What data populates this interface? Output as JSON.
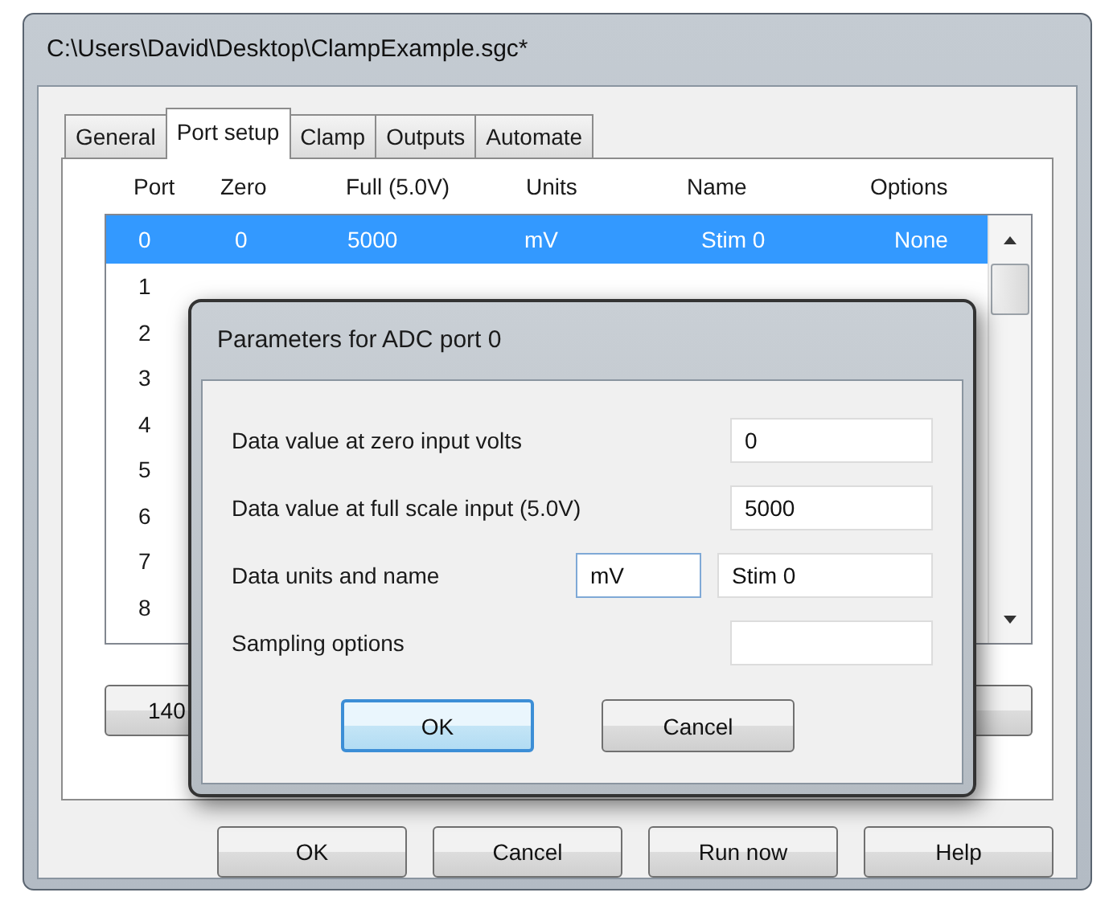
{
  "window": {
    "title": "C:\\Users\\David\\Desktop\\ClampExample.sgc*"
  },
  "tabs": [
    {
      "label": "General",
      "selected": false
    },
    {
      "label": "Port setup",
      "selected": true
    },
    {
      "label": "Clamp",
      "selected": false
    },
    {
      "label": "Outputs",
      "selected": false
    },
    {
      "label": "Automate",
      "selected": false
    }
  ],
  "table": {
    "columns": [
      "Port",
      "Zero",
      "Full (5.0V)",
      "Units",
      "Name",
      "Options"
    ],
    "rows": [
      {
        "selected": true,
        "cells": [
          "0",
          "0",
          "5000",
          "mV",
          "Stim 0",
          "None"
        ]
      },
      {
        "selected": false,
        "cells": [
          "1"
        ]
      },
      {
        "selected": false,
        "cells": [
          "2"
        ]
      },
      {
        "selected": false,
        "cells": [
          "3"
        ]
      },
      {
        "selected": false,
        "cells": [
          "4"
        ]
      },
      {
        "selected": false,
        "cells": [
          "5"
        ]
      },
      {
        "selected": false,
        "cells": [
          "6"
        ]
      },
      {
        "selected": false,
        "cells": [
          "7"
        ]
      },
      {
        "selected": false,
        "cells": [
          "8"
        ]
      }
    ]
  },
  "panel_button": {
    "label": "140"
  },
  "buttons": [
    {
      "label": "OK"
    },
    {
      "label": "Cancel"
    },
    {
      "label": "Run now"
    },
    {
      "label": "Help"
    }
  ],
  "dialog": {
    "title": "Parameters for ADC port 0",
    "rows": [
      {
        "label": "Data value at zero input volts",
        "fields": [
          {
            "value": "0",
            "focused": false
          }
        ]
      },
      {
        "label": "Data value at full scale input (5.0V)",
        "fields": [
          {
            "value": "5000",
            "focused": false
          }
        ]
      },
      {
        "label": "Data units and name",
        "fields": [
          {
            "value": "mV",
            "focused": true
          },
          {
            "value": "Stim 0",
            "focused": false
          }
        ]
      },
      {
        "label": "Sampling options",
        "fields": [
          {
            "focused": false
          }
        ]
      }
    ],
    "buttons": [
      {
        "label": "OK",
        "default": true
      },
      {
        "label": "Cancel",
        "default": false
      }
    ]
  }
}
